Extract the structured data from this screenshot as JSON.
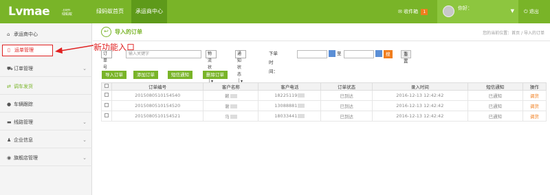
{
  "header": {
    "logo": "Lvmae",
    "logo_sub_top": ".com",
    "logo_sub_bottom": "绿蚂蚁",
    "nav": [
      {
        "label": "绿蚂蚁首页"
      },
      {
        "label": "承运商中心"
      }
    ],
    "inbox_label": "收件箱",
    "inbox_count": "1",
    "greeting": "你好：",
    "logout_label": "退出"
  },
  "sidebar": {
    "items": [
      {
        "label": "承运商中心",
        "icon": "home-icon"
      },
      {
        "label": "运单管理",
        "icon": "document-icon"
      },
      {
        "label": "订单管理",
        "icon": "cart-icon"
      },
      {
        "label": "调车发货",
        "icon": "exchange-icon"
      },
      {
        "label": "车辆跟踪",
        "icon": "location-icon"
      },
      {
        "label": "线路管理",
        "icon": "truck-icon"
      },
      {
        "label": "企业信息",
        "icon": "user-plus-icon"
      },
      {
        "label": "旗舰店管理",
        "icon": "store-icon"
      }
    ]
  },
  "annotation": {
    "text": "新功能入口",
    "color": "#e02020"
  },
  "page": {
    "title": "导入的订单",
    "breadcrumb": "您的当前位置：首页 / 导入的订单"
  },
  "filter": {
    "field_select": "订单号",
    "search_placeholder": "输入关键字",
    "logistics_status_label": "物流状态",
    "sms_status_label": "通知状态",
    "order_time_label": "下单时间：",
    "to_label": "至",
    "search_button": "搜 索",
    "reset_button": "重 置"
  },
  "actions": {
    "import": "导入订单",
    "add": "添加订单",
    "sms": "短信通知",
    "delete": "删除订单"
  },
  "table": {
    "columns": [
      "订单编号",
      "客户名称",
      "客户电话",
      "订单状态",
      "录入时间",
      "短信通知",
      "操作"
    ],
    "rows": [
      {
        "order_no": "2015080510154540",
        "customer": "赖",
        "phone": "18225119",
        "status": "已到达",
        "time": "2016-12-13 12:42:42",
        "sms": "已通知",
        "op": "调货"
      },
      {
        "order_no": "2015080510154520",
        "customer": "谢",
        "phone": "13088881",
        "status": "已到达",
        "time": "2016-12-13 12:42:42",
        "sms": "已通知",
        "op": "调货"
      },
      {
        "order_no": "2015080510154521",
        "customer": "马",
        "phone": "18033441",
        "status": "已到达",
        "time": "2016-12-13 12:42:42",
        "sms": "已通知",
        "op": "调货"
      }
    ]
  },
  "colors": {
    "brand_green": "#79b428",
    "accent_orange": "#f07d1d",
    "annotation_red": "#e02020"
  }
}
